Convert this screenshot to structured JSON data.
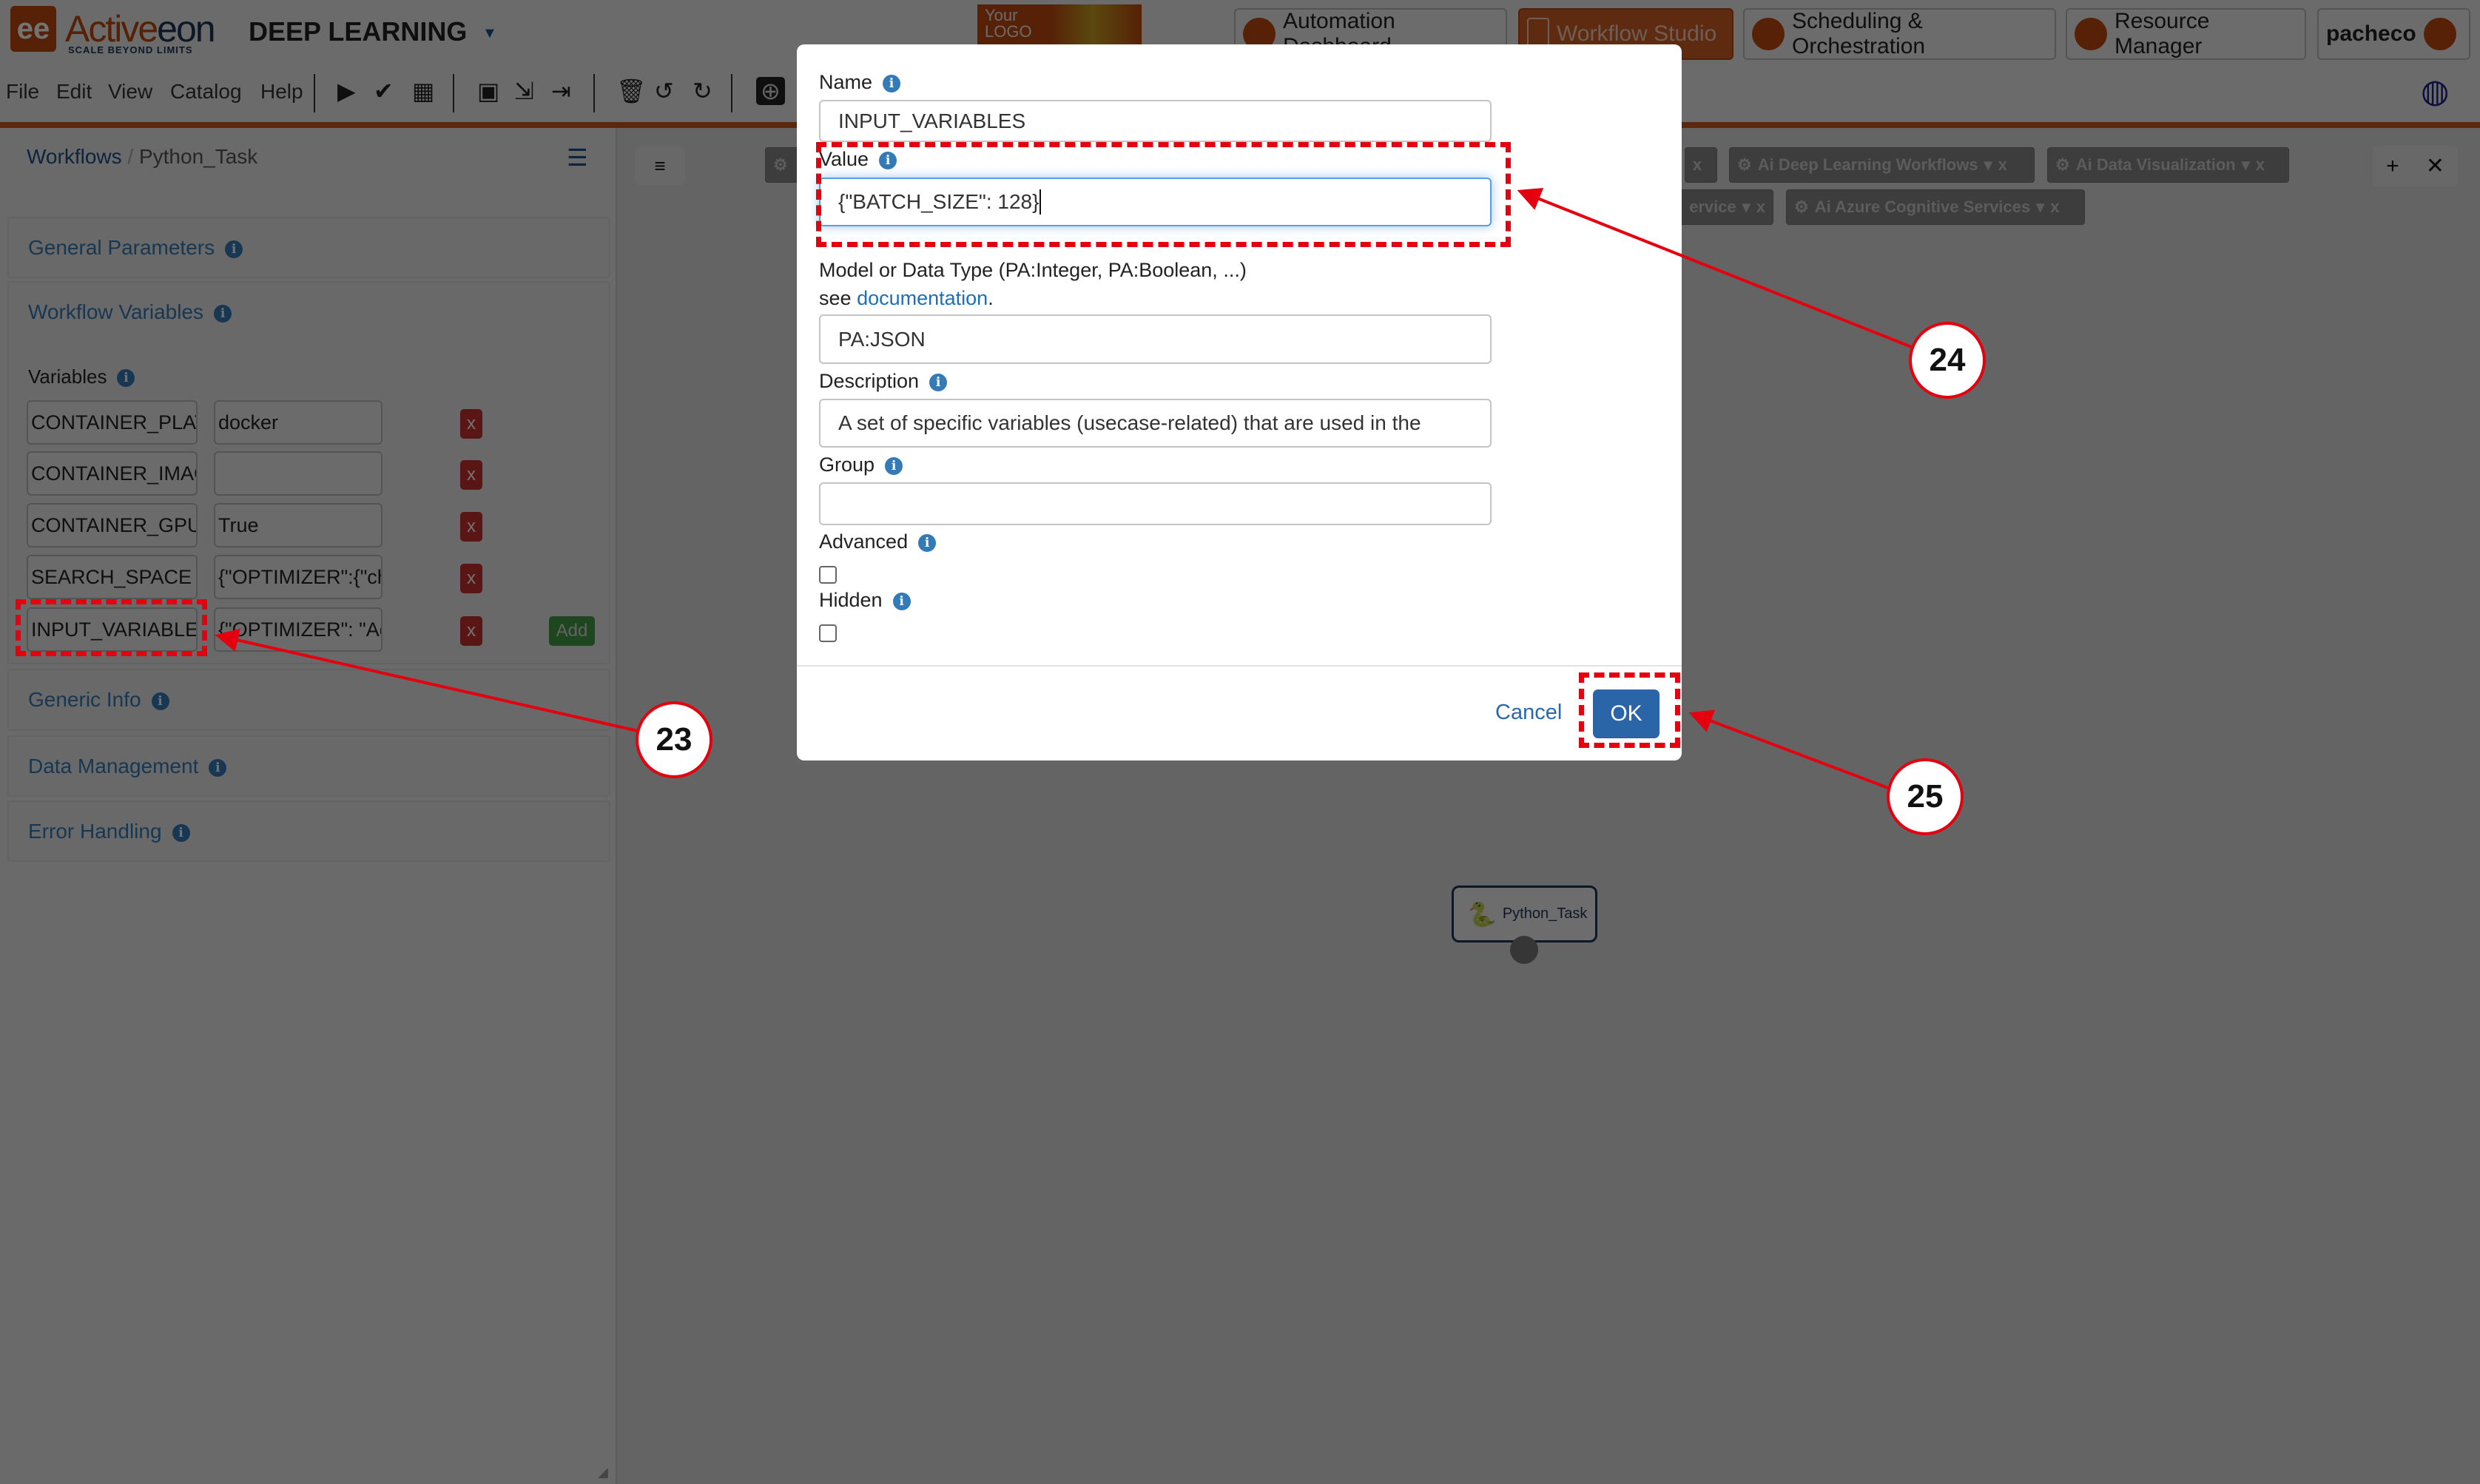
{
  "header": {
    "brand": {
      "logo_mark": "ee",
      "name_part1": "Active",
      "name_part2": "eon",
      "tagline": "SCALE BEYOND LIMITS"
    },
    "app_title": "DEEP LEARNING",
    "custom_logo": {
      "line1": "Your",
      "line2": "LOGO"
    },
    "nav": [
      {
        "label": "Automation Dashboard",
        "active": false
      },
      {
        "label": "Workflow Studio",
        "active": true
      },
      {
        "label": "Scheduling & Orchestration",
        "active": false
      },
      {
        "label": "Resource Manager",
        "active": false
      }
    ],
    "user": "pacheco",
    "accent_color": "#c0490e"
  },
  "menu": {
    "items": [
      "File",
      "Edit",
      "View",
      "Catalog",
      "Help"
    ]
  },
  "toolbar": {
    "icons": [
      "play-icon",
      "check-icon",
      "calendar-icon",
      "save-icon",
      "import-icon",
      "export-icon",
      "trash-icon",
      "undo-icon",
      "redo-icon",
      "catalog-globe-icon"
    ]
  },
  "left_panel": {
    "breadcrumb": {
      "root": "Workflows",
      "separator": "/",
      "current": "Python_Task"
    },
    "sections": {
      "general": "General Parameters",
      "workflow_variables": "Workflow Variables",
      "generic_info": "Generic Info",
      "data_management": "Data Management",
      "error_handling": "Error Handling"
    },
    "variables_label": "Variables",
    "variables": [
      {
        "name": "CONTAINER_PLAT",
        "value": "docker"
      },
      {
        "name": "CONTAINER_IMAG",
        "value": ""
      },
      {
        "name": "CONTAINER_GPU_",
        "value": "True"
      },
      {
        "name": "SEARCH_SPACE",
        "value": "{\"OPTIMIZER\":{\"ch"
      },
      {
        "name": "INPUT_VARIABLES",
        "value": "{\"OPTIMIZER\": \"Ad"
      }
    ],
    "remove_label": "x",
    "add_label": "Add"
  },
  "canvas": {
    "bucket_tabs_row1": [
      {
        "label": ""
      },
      {
        "label": "Ai Deep Learning Workflows"
      },
      {
        "label": "Ai Data Visualization"
      }
    ],
    "bucket_tabs_row2": [
      {
        "label": "ervice"
      },
      {
        "label": "Ai Azure Cognitive Services"
      }
    ],
    "close_label": "x",
    "node": {
      "label": "Python_Task"
    }
  },
  "dialog": {
    "name_label": "Name",
    "name_value": "INPUT_VARIABLES",
    "value_label": "Value",
    "value_value": "{\"BATCH_SIZE\": 128}",
    "model_label": "Model or Data Type (PA:Integer, PA:Boolean, ...)",
    "see_text": "see",
    "doc_link": "documentation",
    "model_value": "PA:JSON",
    "description_label": "Description",
    "description_value": "A set of specific variables (usecase-related) that are used in the",
    "group_label": "Group",
    "group_value": "",
    "advanced_label": "Advanced",
    "advanced_checked": false,
    "hidden_label": "Hidden",
    "hidden_checked": false,
    "cancel_label": "Cancel",
    "ok_label": "OK"
  },
  "annotations": {
    "step_23": "23",
    "step_24": "24",
    "step_25": "25",
    "color": "#e4000f"
  }
}
